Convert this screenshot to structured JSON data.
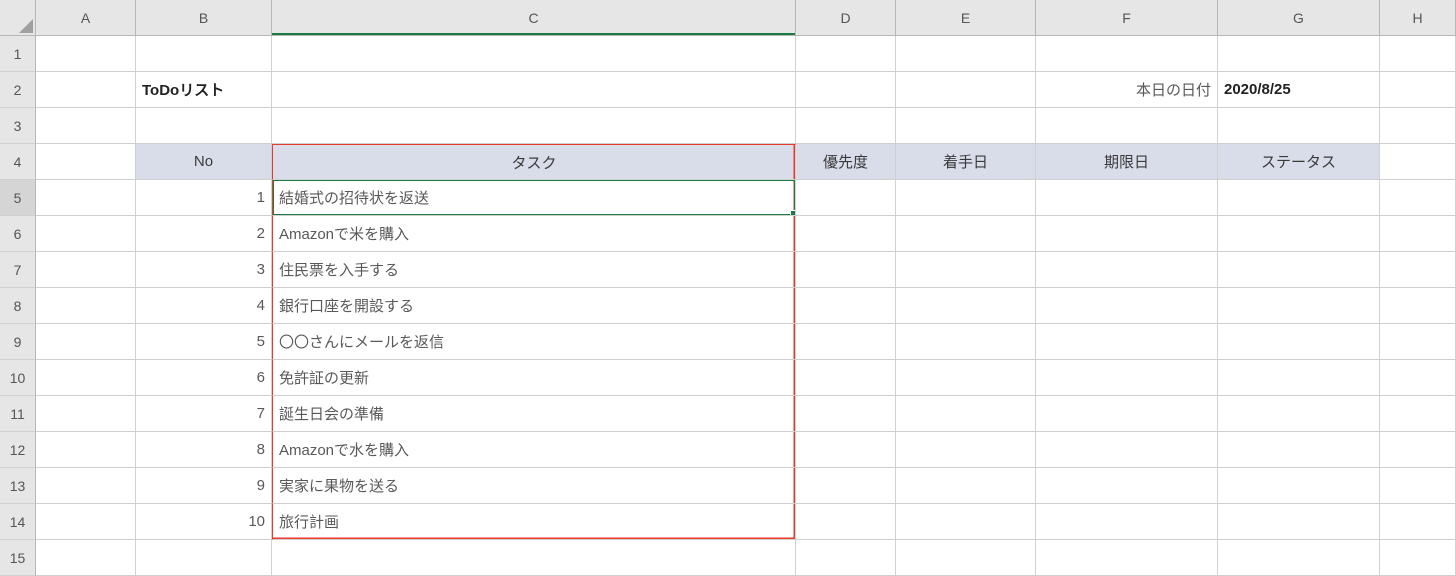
{
  "columns": [
    "A",
    "B",
    "C",
    "D",
    "E",
    "F",
    "G",
    "H"
  ],
  "row_count": 15,
  "title_cell": "ToDoリスト",
  "date_label": "本日の日付",
  "date_value": "2020/8/25",
  "headers": {
    "no": "No",
    "task": "タスク",
    "priority": "優先度",
    "start": "着手日",
    "due": "期限日",
    "status": "ステータス"
  },
  "tasks": [
    {
      "no": 1,
      "name": "結婚式の招待状を返送"
    },
    {
      "no": 2,
      "name": "Amazonで米を購入"
    },
    {
      "no": 3,
      "name": "住民票を入手する"
    },
    {
      "no": 4,
      "name": "銀行口座を開設する"
    },
    {
      "no": 5,
      "name": "〇〇さんにメールを返信"
    },
    {
      "no": 6,
      "name": "免許証の更新"
    },
    {
      "no": 7,
      "name": "誕生日会の準備"
    },
    {
      "no": 8,
      "name": "Amazonで水を購入"
    },
    {
      "no": 9,
      "name": "実家に果物を送る"
    },
    {
      "no": 10,
      "name": "旅行計画"
    }
  ],
  "selected_cell": "C5",
  "highlighted_range": "C4:C14"
}
